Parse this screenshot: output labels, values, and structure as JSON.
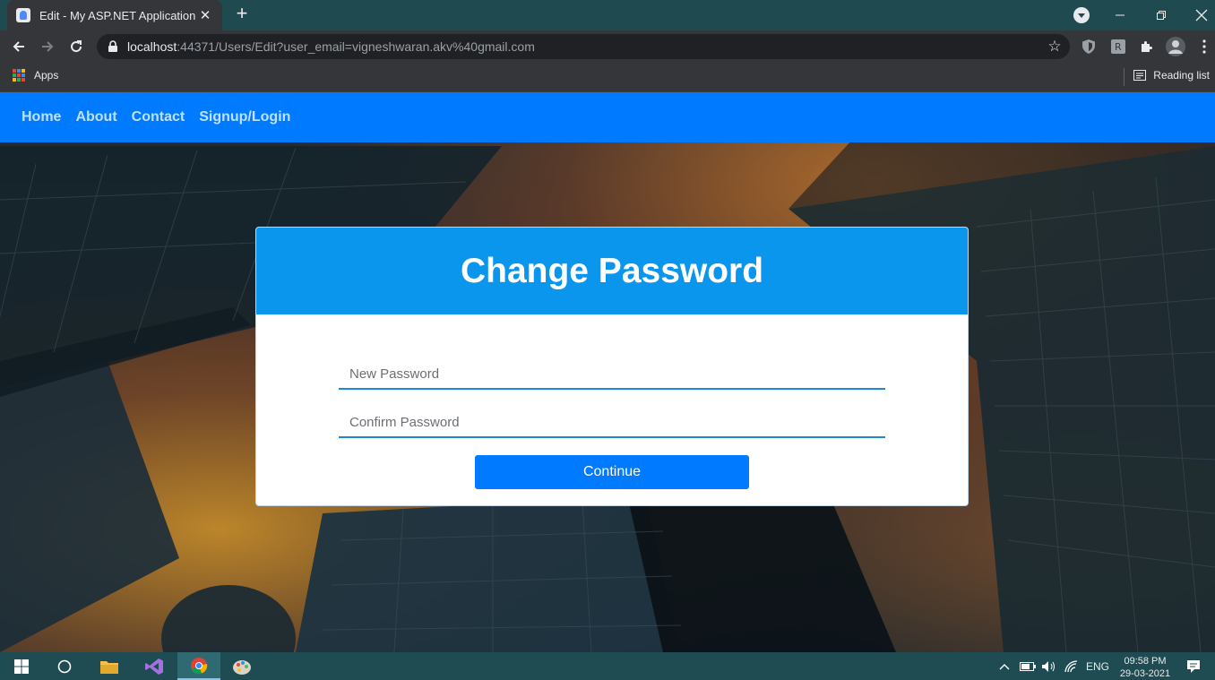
{
  "browser": {
    "tab_title": "Edit - My ASP.NET Application",
    "url_host": "localhost",
    "url_rest": ":44371/Users/Edit?user_email=vigneshwaran.akv%40gmail.com",
    "bookmarks": {
      "apps_label": "Apps",
      "reading_list_label": "Reading list"
    }
  },
  "navbar": {
    "links": [
      "Home",
      "About",
      "Contact",
      "Signup/Login"
    ],
    "color": "#007bff"
  },
  "form": {
    "title": "Change Password",
    "new_password_placeholder": "New Password",
    "confirm_password_placeholder": "Confirm Password",
    "continue_label": "Continue",
    "header_color": "#0a96ec"
  },
  "taskbar": {
    "language": "ENG",
    "time": "09:58 PM",
    "date": "29-03-2021"
  }
}
